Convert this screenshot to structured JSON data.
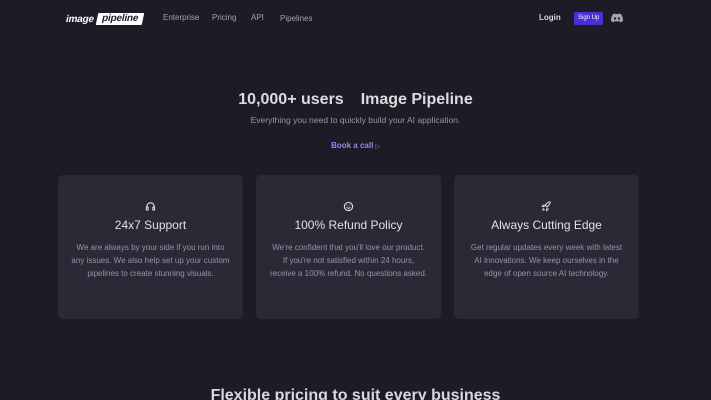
{
  "nav": {
    "logo_left": "image",
    "logo_right": "pipeline",
    "links": [
      "Enterprise",
      "Pricing",
      "API",
      "Pipelines"
    ],
    "login": "Login",
    "signup": "Sign Up",
    "discord_icon": "discord-icon"
  },
  "hero": {
    "title_left": "10,000+ users",
    "title_right": "Image Pipeline",
    "subtitle": "Everything you need to quickly build your AI application.",
    "cta": "Book a call",
    "cta_arrow": "▷"
  },
  "features": [
    {
      "icon": "headset-icon",
      "title": "24x7 Support",
      "lines": [
        "We are always by your side if you run into",
        "any issues. We also help set up your custom",
        "pipelines to create stunning visuals."
      ]
    },
    {
      "icon": "smile-icon",
      "title": "100% Refund Policy",
      "lines": [
        "We're confident that you'll love our product.",
        "If you're not satisfied within 24 hours,",
        "receive a 100% refund. No questions asked."
      ]
    },
    {
      "icon": "rocket-icon",
      "title": "Always Cutting Edge",
      "lines": [
        "Get regular updates every week with latest",
        "AI innovations. We keep ourselves in the",
        "edge of open source AI technology."
      ]
    }
  ],
  "pricing": {
    "heading": "Flexible pricing to suit every business"
  },
  "colors": {
    "background": "#1c1b26",
    "card": "#2a2936",
    "accent": "#4a2fd6",
    "link_accent": "#8d8cf2"
  }
}
